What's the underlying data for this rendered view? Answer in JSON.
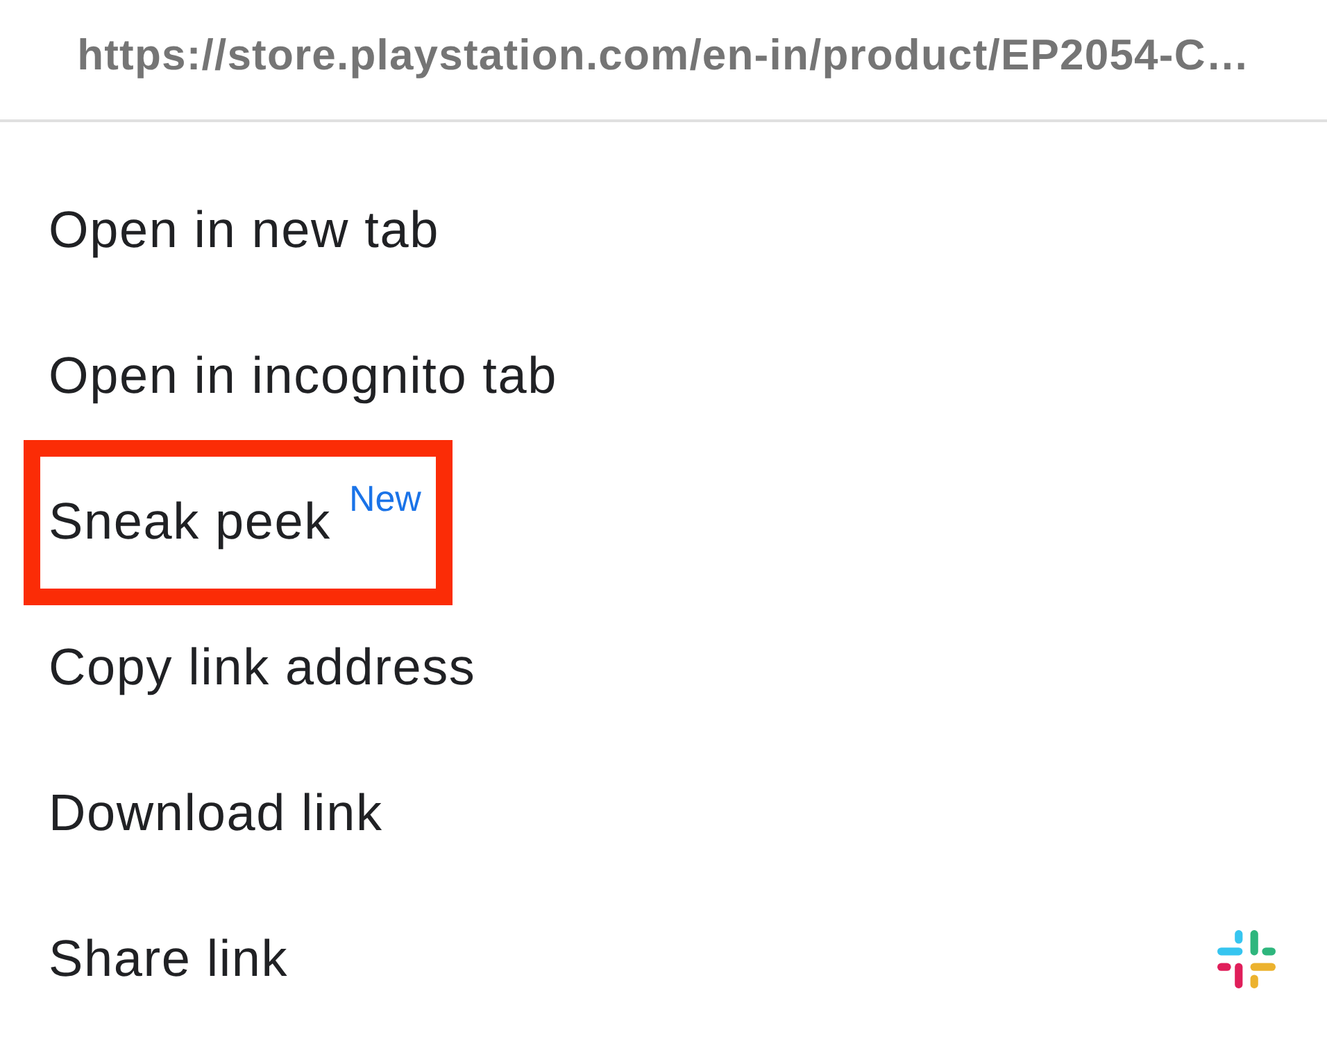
{
  "url_header": {
    "text": "https://store.playstation.com/en-in/product/EP2054-C…"
  },
  "menu": {
    "items": [
      {
        "label": "Open in new tab",
        "kind": "text",
        "highlighted": false
      },
      {
        "label": "Open in incognito tab",
        "kind": "text",
        "highlighted": false
      },
      {
        "label": "Sneak peek",
        "badge": "New",
        "kind": "text",
        "highlighted": true
      },
      {
        "label": "Copy link address",
        "kind": "text",
        "highlighted": false
      },
      {
        "label": "Download link",
        "kind": "text",
        "highlighted": false
      },
      {
        "label": "Share link",
        "kind": "share-target",
        "highlighted": false
      }
    ]
  }
}
